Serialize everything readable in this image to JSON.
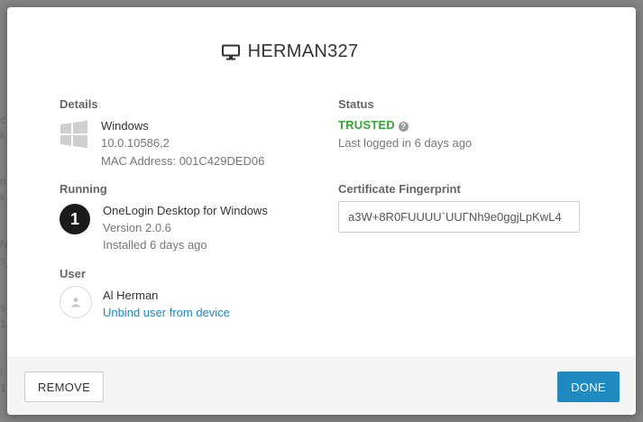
{
  "background": {
    "fragments": [
      "c",
      "k",
      "n",
      "k",
      "N",
      "s",
      "s",
      "1",
      "l",
      "1"
    ]
  },
  "modal": {
    "title": "HERMAN327",
    "title_icon": "monitor-icon"
  },
  "details": {
    "label": "Details",
    "os_name": "Windows",
    "os_version": "10.0.10586,2",
    "mac_address": "MAC Address: 001C429DED06",
    "icon": "windows-logo-icon"
  },
  "running": {
    "label": "Running",
    "badge": "1",
    "app_name": "OneLogin Desktop for Windows",
    "version": "Version 2.0.6",
    "installed": "Installed 6 days ago"
  },
  "user": {
    "label": "User",
    "name": "Al Herman",
    "unbind_link": "Unbind user from device",
    "icon": "user-icon"
  },
  "status": {
    "label": "Status",
    "value": "TRUSTED",
    "last_logged": "Last logged in 6 days ago",
    "icon": "help-icon"
  },
  "certificate": {
    "label": "Certificate Fingerprint",
    "value": "a3W+8R0FUUUU`UUΓNh9e0ggjLpKwL4"
  },
  "footer": {
    "remove_label": "REMOVE",
    "done_label": "DONE"
  },
  "colors": {
    "accent": "#1f8ac0",
    "trusted": "#3aa33a"
  }
}
